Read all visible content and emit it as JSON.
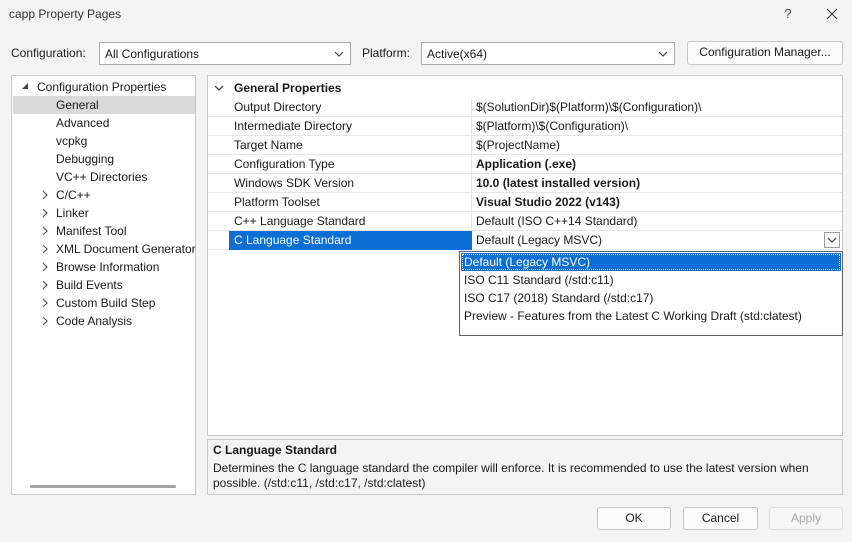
{
  "window": {
    "title": "capp Property Pages",
    "help_label": "?"
  },
  "config_bar": {
    "configuration_label": "Configuration:",
    "configuration_value": "All Configurations",
    "platform_label": "Platform:",
    "platform_value": "Active(x64)",
    "config_manager_label": "Configuration Manager..."
  },
  "tree": {
    "root": "Configuration Properties",
    "items": [
      {
        "label": "General",
        "selected": true,
        "expandable": false
      },
      {
        "label": "Advanced",
        "expandable": false
      },
      {
        "label": "vcpkg",
        "expandable": false
      },
      {
        "label": "Debugging",
        "expandable": false
      },
      {
        "label": "VC++ Directories",
        "expandable": false
      },
      {
        "label": "C/C++",
        "expandable": true
      },
      {
        "label": "Linker",
        "expandable": true
      },
      {
        "label": "Manifest Tool",
        "expandable": true
      },
      {
        "label": "XML Document Generator",
        "expandable": true
      },
      {
        "label": "Browse Information",
        "expandable": true
      },
      {
        "label": "Build Events",
        "expandable": true
      },
      {
        "label": "Custom Build Step",
        "expandable": true
      },
      {
        "label": "Code Analysis",
        "expandable": true
      }
    ]
  },
  "grid": {
    "section": "General Properties",
    "rows": [
      {
        "name": "Output Directory",
        "value": "$(SolutionDir)$(Platform)\\$(Configuration)\\"
      },
      {
        "name": "Intermediate Directory",
        "value": "$(Platform)\\$(Configuration)\\"
      },
      {
        "name": "Target Name",
        "value": "$(ProjectName)"
      },
      {
        "name": "Configuration Type",
        "value": "Application (.exe)",
        "bold": true
      },
      {
        "name": "Windows SDK Version",
        "value": "10.0 (latest installed version)",
        "bold": true
      },
      {
        "name": "Platform Toolset",
        "value": "Visual Studio 2022 (v143)",
        "bold": true
      },
      {
        "name": "C++ Language Standard",
        "value": "Default (ISO C++14 Standard)"
      },
      {
        "name": "C Language Standard",
        "value": "Default (Legacy MSVC)",
        "selected": true
      }
    ]
  },
  "dropdown": {
    "options": [
      "Default (Legacy MSVC)",
      "ISO C11 Standard (/std:c11)",
      "ISO C17 (2018) Standard (/std:c17)",
      "Preview - Features from the Latest C Working Draft (std:clatest)"
    ],
    "highlighted_index": 0
  },
  "description": {
    "title": "C Language Standard",
    "text": "Determines the C language standard the compiler will enforce. It is recommended to use the latest version when possible.  (/std:c11, /std:c17, /std:clatest)"
  },
  "buttons": {
    "ok": "OK",
    "cancel": "Cancel",
    "apply": "Apply"
  },
  "colors": {
    "selection": "#0a6fd4",
    "background": "#f3f3f3"
  }
}
